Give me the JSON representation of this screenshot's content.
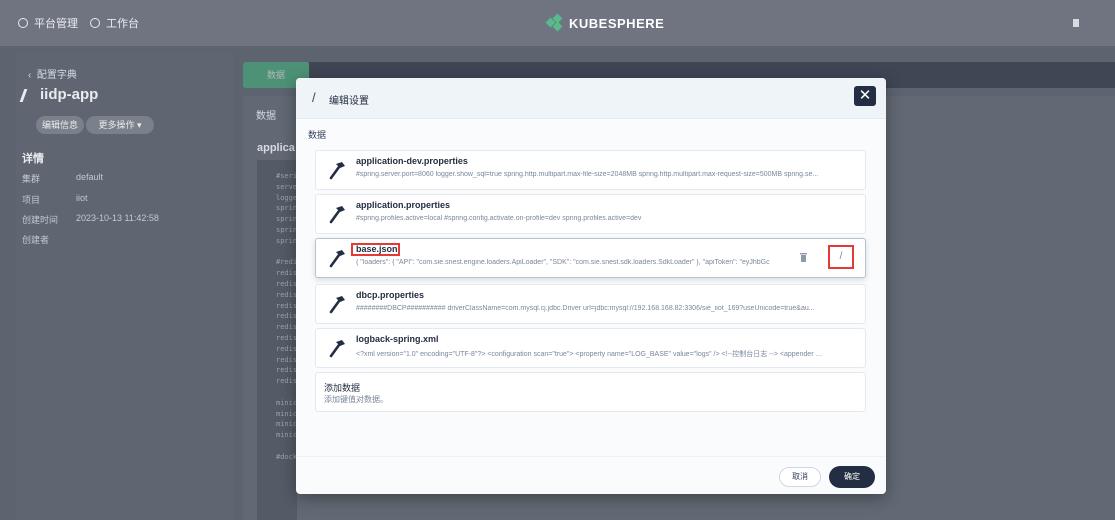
{
  "topbar": {
    "platform_label": "平台管理",
    "workbench_label": "工作台",
    "brand": "KUBESPHERE"
  },
  "left": {
    "back_label": "配置字典",
    "app_name": "iidp-app",
    "edit_info_label": "编辑信息",
    "more_label": "更多操作 ▾",
    "detail_title": "详情",
    "details": [
      {
        "k": "集群",
        "v": "default"
      },
      {
        "k": "项目",
        "v": "iiot"
      },
      {
        "k": "创建时间",
        "v": "2023-10-13 11:42:58"
      },
      {
        "k": "创建者",
        "v": ""
      }
    ]
  },
  "right": {
    "tab_label": "数据",
    "data_label": "数据",
    "panel_title": "applica"
  },
  "code_lines": [
    "#seri",
    "serve",
    "logge",
    "sprin",
    "sprin",
    "sprin",
    "sprin",
    "",
    "#redi",
    "redis",
    "redis",
    "redis",
    "redis",
    "redis",
    "redis",
    "redis",
    "redis",
    "redis",
    "redis",
    "redis",
    "",
    "minic",
    "minic",
    "minic",
    "minic",
    "",
    "#docker-install"
  ],
  "modal": {
    "title": "编辑设置",
    "section_label": "数据",
    "close_symbol": "✕",
    "items": [
      {
        "name": "application-dev.properties",
        "desc": "#spring.server.port=8060 logger.show_sql=true spring.http.multipart.max-file-size=2048MB spring.http.multipart.max-request-size=500MB spring.se..."
      },
      {
        "name": "application.properties",
        "desc": "#spring.profiles.active=local #spring.config.activate.on-profile=dev spring.profiles.active=dev"
      },
      {
        "name": "base.json",
        "desc": "{ \"loaders\": { \"API\": \"com.sie.snest.engine.loaders.ApiLoader\", \"SDK\": \"com.sie.snest.sdk.loaders.SdkLoader\" }, \"apiToken\": \"eyJhbGc"
      },
      {
        "name": "dbcp.properties",
        "desc": "########DBCP########## driverClassName=com.mysql.cj.jdbc.Driver url=jdbc:mysql://192.168.168.82:3306/sie_iiot_169?useUnicode=true&au..."
      },
      {
        "name": "logback-spring.xml",
        "desc": "<?xml version=\"1.0\" encoding=\"UTF-8\"?> <configuration scan=\"true\"> <property name=\"LOG_BASE\" value=\"logs\" /> <!--控制台日志 --> <appender nam..."
      }
    ],
    "add_title": "添加数据",
    "add_desc": "添加键值对数据。",
    "cancel_label": "取消",
    "ok_label": "确定"
  },
  "colors": {
    "accent_green": "#55bc8a",
    "dark_button": "#242e42",
    "highlight_red": "#e53935"
  }
}
